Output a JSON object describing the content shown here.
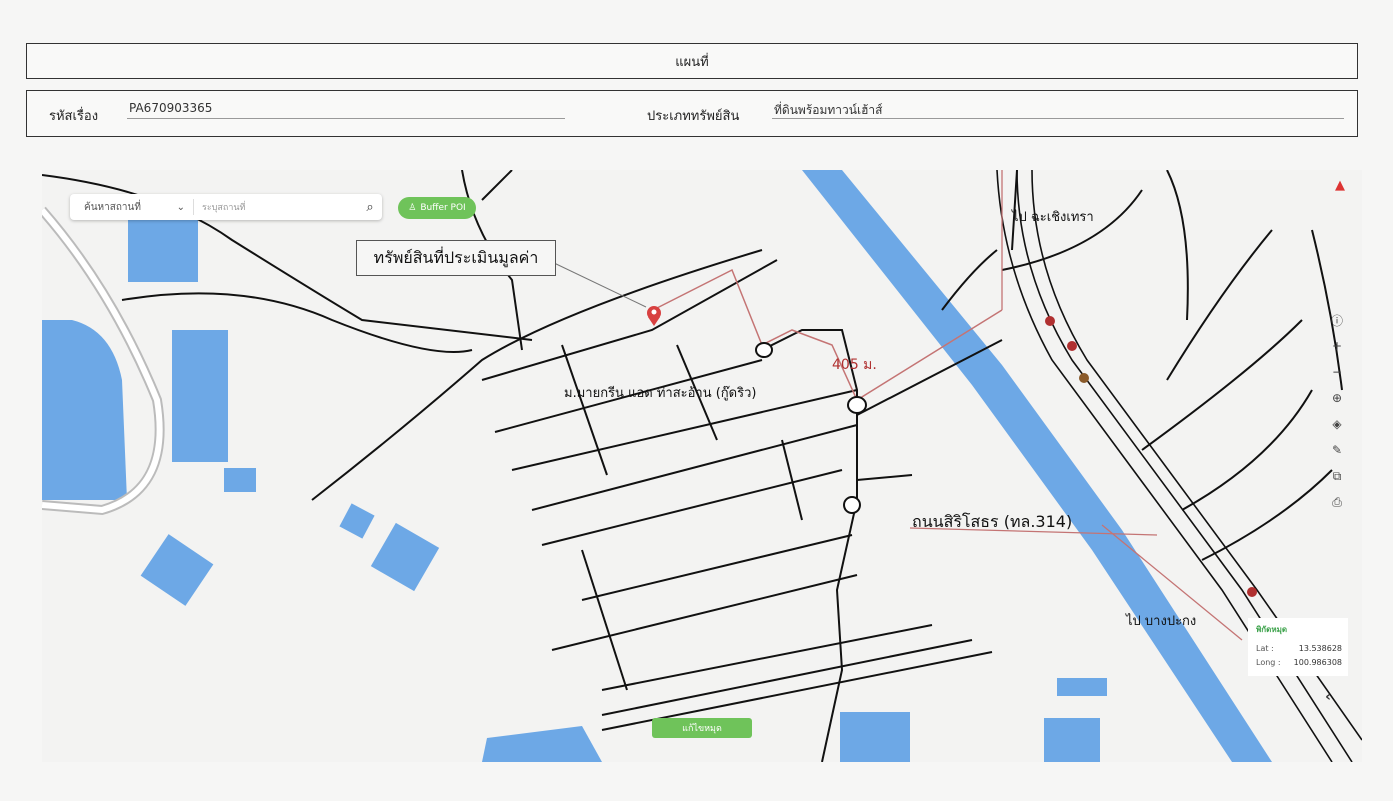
{
  "header": {
    "title": "แผนที่"
  },
  "info": {
    "case_label": "รหัสเรื่อง",
    "case_value": "PA670903365",
    "type_label": "ประเภททรัพย์สิน",
    "type_value": "ที่ดินพร้อมทาวน์เฮ้าส์"
  },
  "map": {
    "search_select": "ค้นหาสถานที่",
    "search_placeholder": "ระบุสถานที่",
    "buffer_button": "Buffer POI",
    "callout": "ทรัพย์สินที่ประเมินมูลค่า",
    "distance": "405 ม.",
    "village": "ม.มายกรีน แอด ท่าสะอ้าน (กู๊ดริว)",
    "to_chachoengsao": "ไป ฉะเชิงเทรา",
    "road": "ถนนสิริโสธร (ทล.314)",
    "to_bang_pakong": "ไป บางปะกง",
    "reset_button": "แก้ไขหมุด",
    "coords": {
      "title": "พิกัดหมุด",
      "lat_label": "Lat :",
      "lat_value": "13.538628",
      "long_label": "Long :",
      "long_value": "100.986308"
    }
  },
  "colors": {
    "water": "#6da8e6",
    "road": "#111111",
    "route": "#c47474",
    "button": "#6fc35a"
  }
}
